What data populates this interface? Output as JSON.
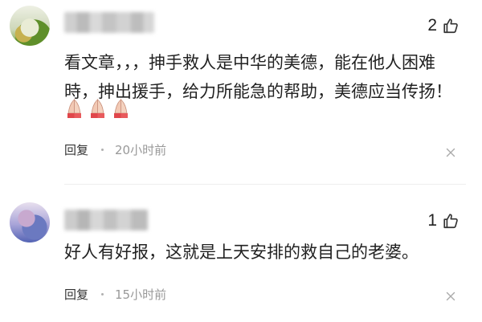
{
  "comments": [
    {
      "like_count": "2",
      "text": "看文章，，，抻手救人是中华的美德，能在他人困难時，抻出援手，给力所能急的帮助，美德应当传扬！",
      "emojis": [
        "folded-hands-icon",
        "folded-hands-icon",
        "folded-hands-icon"
      ],
      "reply_label": "回复",
      "time": "20小时前"
    },
    {
      "like_count": "1",
      "text": "好人有好报，这就是上天安排的救自己的老婆。",
      "reply_label": "回复",
      "time": "15小时前"
    }
  ],
  "colors": {
    "text": "#222222",
    "meta": "#999999",
    "emoji_skin": "#f2c9b4",
    "emoji_sleeve": "#e0464a"
  }
}
